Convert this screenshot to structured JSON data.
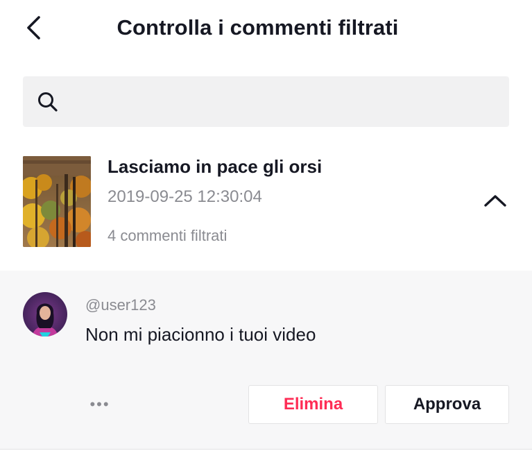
{
  "header": {
    "title": "Controlla i commenti filtrati",
    "back_icon": "chevron-left-icon"
  },
  "search": {
    "icon": "search-icon",
    "placeholder": "",
    "value": ""
  },
  "video": {
    "title": "Lasciamo in pace gli orsi",
    "datetime": "2019-09-25 12:30:04",
    "filtered_count": "4 commenti filtrati",
    "expand_icon": "chevron-up-icon",
    "expanded": true
  },
  "comment": {
    "username": "@user123",
    "text": "Non mi piacionno i tuoi video",
    "more_label": "•••",
    "delete_label": "Elimina",
    "approve_label": "Approva"
  },
  "colors": {
    "text_primary": "#161823",
    "text_secondary": "#8a8b91",
    "accent_delete": "#fe2c55",
    "search_bg": "#f1f1f2",
    "panel_bg": "#f7f7f8"
  }
}
